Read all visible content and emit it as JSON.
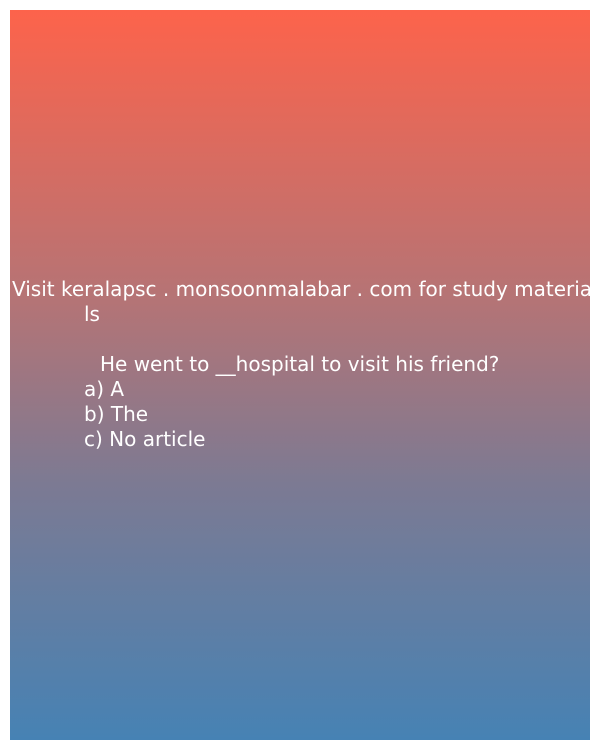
{
  "promo": {
    "line1": "Visit keralapsc . monsoonmalabar . com for study materia",
    "line2": "ls"
  },
  "question": {
    "text": "He went to __hospital to visit his friend?"
  },
  "options": [
    {
      "label": "a) A"
    },
    {
      "label": "b) The"
    },
    {
      "label": "c) No article"
    }
  ],
  "colors": {
    "gradient_top": "#fd634b",
    "gradient_bottom": "#4682b4",
    "text": "#ffffff"
  }
}
